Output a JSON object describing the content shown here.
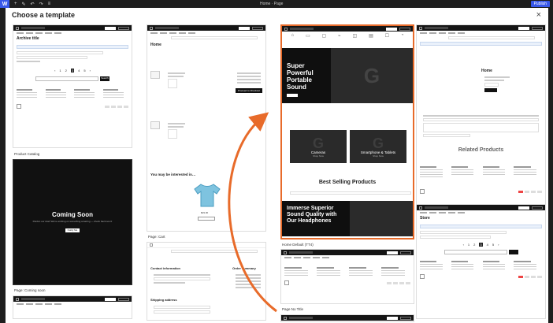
{
  "wp_bar": {
    "page_title": "Home · Page",
    "publish_label": "Publish"
  },
  "modal": {
    "title": "Choose a template",
    "close_label": "×"
  },
  "templates": [
    {
      "id": "archive",
      "label": "Product Catalog",
      "preview_heading": "Archive title",
      "button": "Search"
    },
    {
      "id": "coming-soon",
      "label": "Page: Coming soon",
      "preview_heading": "Coming Soon",
      "preview_sub": "Pardon our dust! We're working on something amazing — check back soon!",
      "button": "Notify Me"
    },
    {
      "id": "cart",
      "label": "Page: Cart",
      "preview_heading": "Home",
      "interested": "You may be interested in…",
      "checkout_button": "Proceed to Checkout"
    },
    {
      "id": "checkout",
      "label": "",
      "contact_heading": "Contact information",
      "shipping_heading": "Shipping address",
      "order_summary": "Order summary"
    },
    {
      "id": "home",
      "label": "Home Default (TT4)",
      "hero_title": "Super Powerful Portable Sound",
      "hero_button": "Shop Now",
      "cat1": "Cameras",
      "cat2": "Smartphone & Tablets",
      "cat_sub": "Shop Now",
      "best_selling": "Best Selling Products",
      "hero2_title": "Immerse Superior Sound Quality with Our Headphones",
      "selected": true
    },
    {
      "id": "page-title",
      "label": "Page No Title"
    },
    {
      "id": "single-product",
      "label": "Single Product",
      "preview_heading": "Home",
      "related": "Related Products"
    },
    {
      "id": "store",
      "label": "",
      "preview_heading": "Store"
    }
  ],
  "header": {
    "search_placeholder": "Search products",
    "btn1": "Become a Seller",
    "btn2": "Customer Care"
  },
  "footer_cols": [
    "Privacy Policy",
    "My account",
    "Terms of use",
    "Contact"
  ],
  "colors": {
    "accent": "#e86b2a",
    "admin": "#1e1e1e",
    "wp_blue": "#3858e9"
  },
  "cart_price": "$29.00"
}
